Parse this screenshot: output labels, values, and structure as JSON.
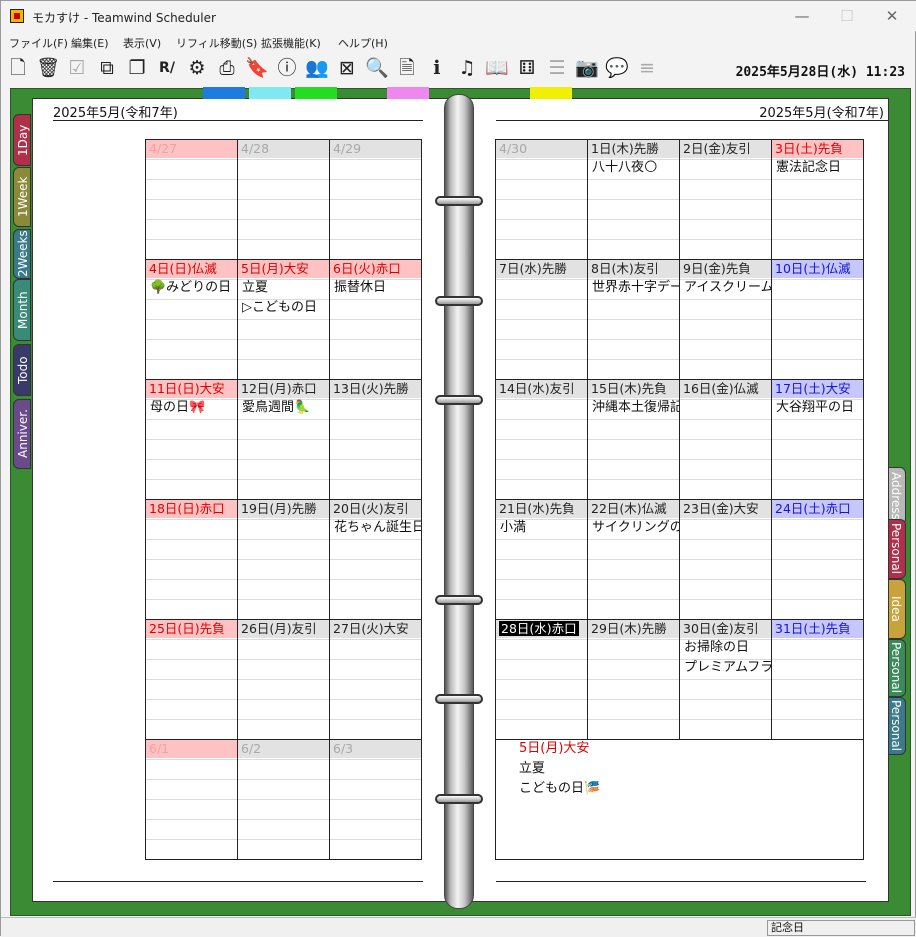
{
  "window": {
    "title": "モカすけ - Teamwind Scheduler",
    "controls": [
      "—",
      "☐",
      "✕"
    ]
  },
  "menu": [
    "ファイル(F)",
    "編集(E)",
    "表示(V)",
    "リフィル移動(S)",
    "拡張機能(K)",
    "ヘルプ(H)"
  ],
  "toolbar_icons": [
    "new-file-icon",
    "trash-icon",
    "checkbox-icon",
    "copy-icon",
    "paste-icon",
    "spellcheck-icon",
    "gear-icon",
    "print-icon",
    "bookmark-icon",
    "help-icon",
    "users-icon",
    "delete-icon",
    "search-icon",
    "document-icon",
    "info-icon",
    "music-icon",
    "book-icon",
    "puzzle-icon",
    "list-icon",
    "camera-icon",
    "chat-icon",
    "align-icon"
  ],
  "clock": "2025年5月28日(水) 11:23",
  "left_page": {
    "header": "2025年5月(令和7年)"
  },
  "right_page": {
    "header": "2025年5月(令和7年)"
  },
  "left_tabs": [
    {
      "label": "1Day",
      "color": "#b0304a"
    },
    {
      "label": "1Week",
      "color": "#8a8a3a"
    },
    {
      "label": "2Weeks",
      "color": "#3a7a88"
    },
    {
      "label": "Month",
      "color": "#3a8a7a"
    },
    {
      "label": "Todo",
      "color": "#3a3a6a"
    },
    {
      "label": "Anniver.",
      "color": "#6a4a8a"
    }
  ],
  "right_tabs": [
    {
      "label": "Address",
      "color": "#b8b8b8"
    },
    {
      "label": "Personal",
      "color": "#b0304a"
    },
    {
      "label": "Idea",
      "color": "#c8a23a"
    },
    {
      "label": "Personal",
      "color": "#3a8a5a"
    },
    {
      "label": "Personal",
      "color": "#3a7a8a"
    }
  ],
  "top_color_tabs": [
    "#1e7be0",
    "#7fe8f0",
    "#22dd22",
    "#ee88ee",
    "#f0f000"
  ],
  "left_weeks": [
    [
      {
        "h": "4/27",
        "s": "fred",
        "e": []
      },
      {
        "h": "4/28",
        "s": "fgray",
        "e": []
      },
      {
        "h": "4/29",
        "s": "fgray",
        "e": []
      }
    ],
    [
      {
        "h": "4日(日)仏滅",
        "s": "red",
        "e": [
          "🌳みどりの日"
        ]
      },
      {
        "h": "5日(月)大安",
        "s": "red",
        "e": [
          "立夏",
          "▷こどもの日"
        ]
      },
      {
        "h": "6日(火)赤口",
        "s": "red",
        "e": [
          "振替休日"
        ]
      }
    ],
    [
      {
        "h": "11日(日)大安",
        "s": "red",
        "e": [
          "母の日🎀"
        ]
      },
      {
        "h": "12日(月)赤口",
        "s": "gray",
        "e": [
          "愛鳥週間🦜"
        ]
      },
      {
        "h": "13日(火)先勝",
        "s": "gray",
        "e": []
      }
    ],
    [
      {
        "h": "18日(日)赤口",
        "s": "red",
        "e": []
      },
      {
        "h": "19日(月)先勝",
        "s": "gray",
        "e": []
      },
      {
        "h": "20日(火)友引",
        "s": "gray",
        "e": [
          "花ちゃん誕生日"
        ]
      }
    ],
    [
      {
        "h": "25日(日)先負",
        "s": "red",
        "e": []
      },
      {
        "h": "26日(月)友引",
        "s": "gray",
        "e": []
      },
      {
        "h": "27日(火)大安",
        "s": "gray",
        "e": []
      }
    ],
    [
      {
        "h": "6/1",
        "s": "fred",
        "e": []
      },
      {
        "h": "6/2",
        "s": "fgray",
        "e": []
      },
      {
        "h": "6/3",
        "s": "fgray",
        "e": []
      }
    ]
  ],
  "right_weeks": [
    [
      {
        "h": "4/30",
        "s": "fgray",
        "e": []
      },
      {
        "h": "1日(木)先勝",
        "s": "gray",
        "e": [
          "八十八夜🌕"
        ]
      },
      {
        "h": "2日(金)友引",
        "s": "gray",
        "e": []
      },
      {
        "h": "3日(土)先負",
        "s": "red",
        "e": [
          "憲法記念日"
        ]
      }
    ],
    [
      {
        "h": "7日(水)先勝",
        "s": "gray",
        "e": []
      },
      {
        "h": "8日(木)友引",
        "s": "gray",
        "e": [
          "世界赤十字デー"
        ]
      },
      {
        "h": "9日(金)先負",
        "s": "gray",
        "e": [
          "アイスクリームの日"
        ]
      },
      {
        "h": "10日(土)仏滅",
        "s": "blue",
        "e": []
      }
    ],
    [
      {
        "h": "14日(水)友引",
        "s": "gray",
        "e": []
      },
      {
        "h": "15日(木)先負",
        "s": "gray",
        "e": [
          "沖縄本土復帰記念日"
        ]
      },
      {
        "h": "16日(金)仏滅",
        "s": "gray",
        "e": []
      },
      {
        "h": "17日(土)大安",
        "s": "blue",
        "e": [
          "大谷翔平の日"
        ]
      }
    ],
    [
      {
        "h": "21日(水)先負",
        "s": "gray",
        "e": [
          "小満"
        ]
      },
      {
        "h": "22日(木)仏滅",
        "s": "gray",
        "e": [
          "サイクリングの日"
        ]
      },
      {
        "h": "23日(金)大安",
        "s": "gray",
        "e": []
      },
      {
        "h": "24日(土)赤口",
        "s": "blue",
        "e": []
      }
    ],
    [
      {
        "h": "28日(水)赤口",
        "s": "today",
        "e": []
      },
      {
        "h": "29日(木)先勝",
        "s": "gray",
        "e": []
      },
      {
        "h": "30日(金)友引",
        "s": "gray",
        "e": [
          "お掃除の日",
          "プレミアムフライデー"
        ]
      },
      {
        "h": "31日(土)先負",
        "s": "blue",
        "e": []
      }
    ]
  ],
  "detail": {
    "header": "5日(月)大安",
    "lines": [
      "立夏",
      "こどもの日🎏"
    ]
  },
  "status": {
    "pane": "記念日"
  }
}
